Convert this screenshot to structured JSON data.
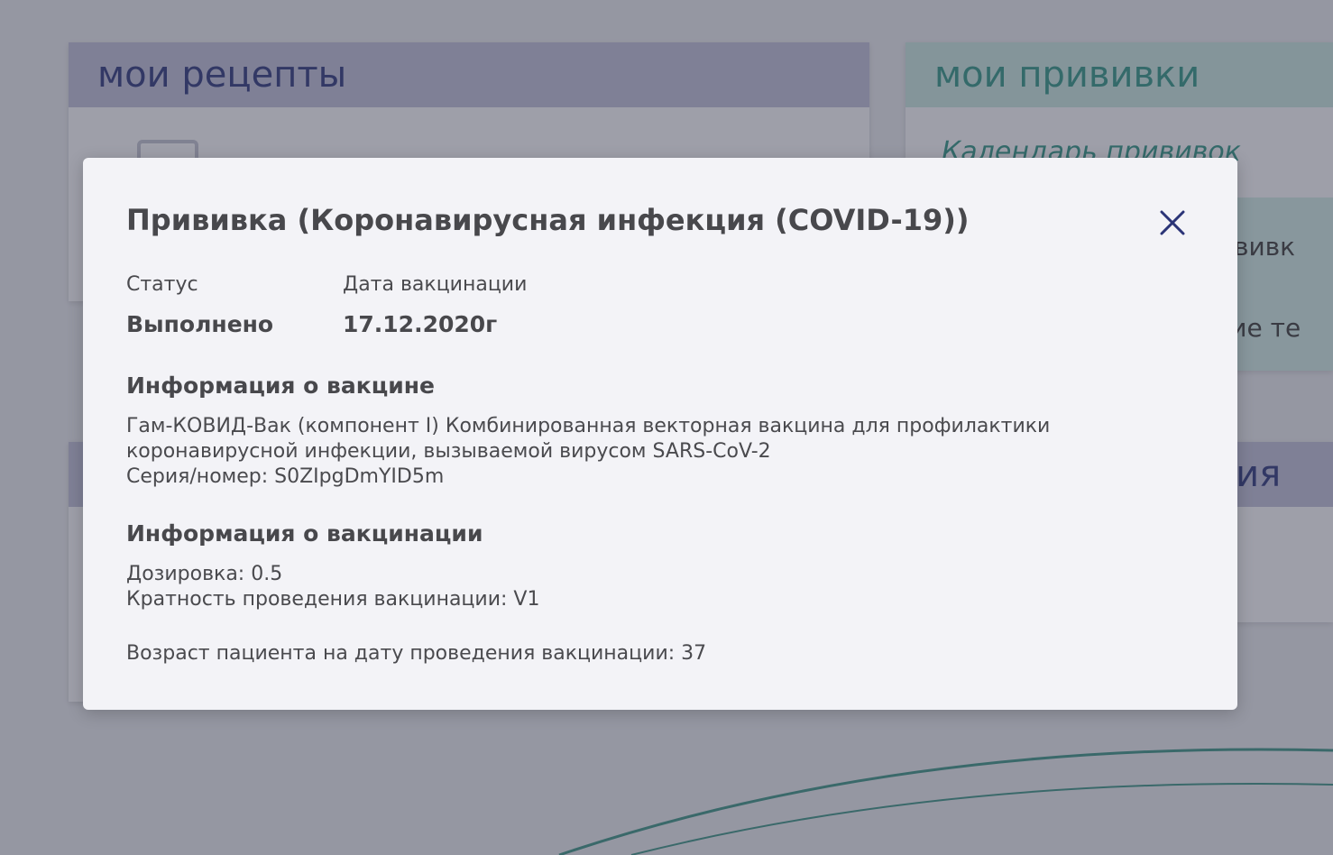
{
  "background": {
    "recipes_card": {
      "title": "мои рецепты"
    },
    "vaccinations_card": {
      "title": "мои прививки",
      "calendar_link": "Календарь прививок",
      "sub_item_1": "рививк",
      "sub_item_2": "ские те"
    },
    "bottom_right_card": {
      "title": "ния"
    }
  },
  "modal": {
    "title": "Прививка (Коронавирусная инфекция (COVID-19))",
    "status": {
      "label": "Статус",
      "value": "Выполнено"
    },
    "date": {
      "label": "Дата вакцинации",
      "value": "17.12.2020г"
    },
    "vaccine_info": {
      "heading": "Информация о вакцине",
      "line1": "Гам-КОВИД-Вак (компонент I) Комбинированная векторная вакцина для профилактики",
      "line2": "коронавирусной инфекции, вызываемой вирусом SARS-CoV-2",
      "line3": "Серия/номер: S0ZIpgDmYID5m"
    },
    "vaccination_info": {
      "heading": "Информация о вакцинации",
      "dosage": "Дозировка: 0.5",
      "multiplicity": "Кратность проведения вакцинации: V1",
      "patient_age": "Возраст пациента на дату проведения вакцинации: 37"
    }
  },
  "colors": {
    "primary_navy": "#2b3477",
    "accent_teal": "#2e8e80",
    "modal_bg": "#f3f3f7",
    "text": "#48484c"
  },
  "icons": {
    "close": "close-icon"
  }
}
